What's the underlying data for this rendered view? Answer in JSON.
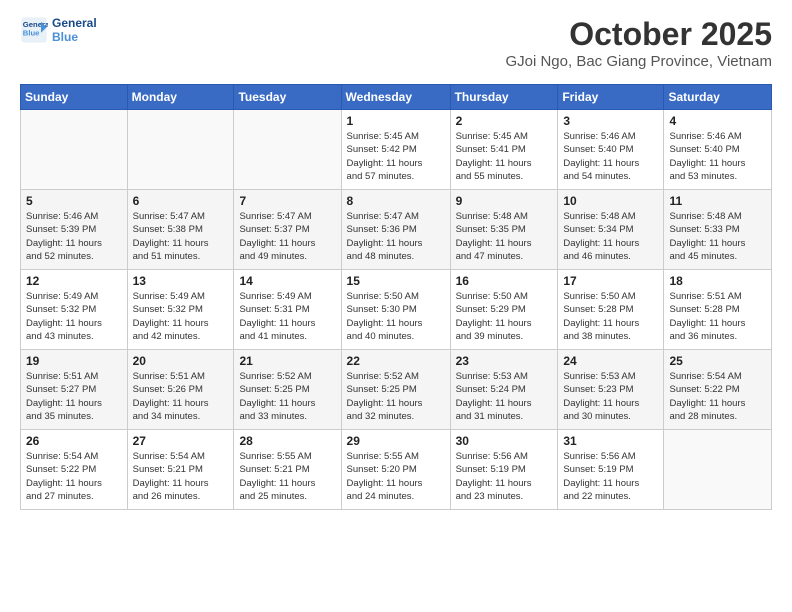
{
  "app": {
    "logo_line1": "General",
    "logo_line2": "Blue"
  },
  "header": {
    "month": "October 2025",
    "location": "GJoi Ngo, Bac Giang Province, Vietnam"
  },
  "weekdays": [
    "Sunday",
    "Monday",
    "Tuesday",
    "Wednesday",
    "Thursday",
    "Friday",
    "Saturday"
  ],
  "weeks": [
    [
      {
        "day": "",
        "info": ""
      },
      {
        "day": "",
        "info": ""
      },
      {
        "day": "",
        "info": ""
      },
      {
        "day": "1",
        "info": "Sunrise: 5:45 AM\nSunset: 5:42 PM\nDaylight: 11 hours\nand 57 minutes."
      },
      {
        "day": "2",
        "info": "Sunrise: 5:45 AM\nSunset: 5:41 PM\nDaylight: 11 hours\nand 55 minutes."
      },
      {
        "day": "3",
        "info": "Sunrise: 5:46 AM\nSunset: 5:40 PM\nDaylight: 11 hours\nand 54 minutes."
      },
      {
        "day": "4",
        "info": "Sunrise: 5:46 AM\nSunset: 5:40 PM\nDaylight: 11 hours\nand 53 minutes."
      }
    ],
    [
      {
        "day": "5",
        "info": "Sunrise: 5:46 AM\nSunset: 5:39 PM\nDaylight: 11 hours\nand 52 minutes."
      },
      {
        "day": "6",
        "info": "Sunrise: 5:47 AM\nSunset: 5:38 PM\nDaylight: 11 hours\nand 51 minutes."
      },
      {
        "day": "7",
        "info": "Sunrise: 5:47 AM\nSunset: 5:37 PM\nDaylight: 11 hours\nand 49 minutes."
      },
      {
        "day": "8",
        "info": "Sunrise: 5:47 AM\nSunset: 5:36 PM\nDaylight: 11 hours\nand 48 minutes."
      },
      {
        "day": "9",
        "info": "Sunrise: 5:48 AM\nSunset: 5:35 PM\nDaylight: 11 hours\nand 47 minutes."
      },
      {
        "day": "10",
        "info": "Sunrise: 5:48 AM\nSunset: 5:34 PM\nDaylight: 11 hours\nand 46 minutes."
      },
      {
        "day": "11",
        "info": "Sunrise: 5:48 AM\nSunset: 5:33 PM\nDaylight: 11 hours\nand 45 minutes."
      }
    ],
    [
      {
        "day": "12",
        "info": "Sunrise: 5:49 AM\nSunset: 5:32 PM\nDaylight: 11 hours\nand 43 minutes."
      },
      {
        "day": "13",
        "info": "Sunrise: 5:49 AM\nSunset: 5:32 PM\nDaylight: 11 hours\nand 42 minutes."
      },
      {
        "day": "14",
        "info": "Sunrise: 5:49 AM\nSunset: 5:31 PM\nDaylight: 11 hours\nand 41 minutes."
      },
      {
        "day": "15",
        "info": "Sunrise: 5:50 AM\nSunset: 5:30 PM\nDaylight: 11 hours\nand 40 minutes."
      },
      {
        "day": "16",
        "info": "Sunrise: 5:50 AM\nSunset: 5:29 PM\nDaylight: 11 hours\nand 39 minutes."
      },
      {
        "day": "17",
        "info": "Sunrise: 5:50 AM\nSunset: 5:28 PM\nDaylight: 11 hours\nand 38 minutes."
      },
      {
        "day": "18",
        "info": "Sunrise: 5:51 AM\nSunset: 5:28 PM\nDaylight: 11 hours\nand 36 minutes."
      }
    ],
    [
      {
        "day": "19",
        "info": "Sunrise: 5:51 AM\nSunset: 5:27 PM\nDaylight: 11 hours\nand 35 minutes."
      },
      {
        "day": "20",
        "info": "Sunrise: 5:51 AM\nSunset: 5:26 PM\nDaylight: 11 hours\nand 34 minutes."
      },
      {
        "day": "21",
        "info": "Sunrise: 5:52 AM\nSunset: 5:25 PM\nDaylight: 11 hours\nand 33 minutes."
      },
      {
        "day": "22",
        "info": "Sunrise: 5:52 AM\nSunset: 5:25 PM\nDaylight: 11 hours\nand 32 minutes."
      },
      {
        "day": "23",
        "info": "Sunrise: 5:53 AM\nSunset: 5:24 PM\nDaylight: 11 hours\nand 31 minutes."
      },
      {
        "day": "24",
        "info": "Sunrise: 5:53 AM\nSunset: 5:23 PM\nDaylight: 11 hours\nand 30 minutes."
      },
      {
        "day": "25",
        "info": "Sunrise: 5:54 AM\nSunset: 5:22 PM\nDaylight: 11 hours\nand 28 minutes."
      }
    ],
    [
      {
        "day": "26",
        "info": "Sunrise: 5:54 AM\nSunset: 5:22 PM\nDaylight: 11 hours\nand 27 minutes."
      },
      {
        "day": "27",
        "info": "Sunrise: 5:54 AM\nSunset: 5:21 PM\nDaylight: 11 hours\nand 26 minutes."
      },
      {
        "day": "28",
        "info": "Sunrise: 5:55 AM\nSunset: 5:21 PM\nDaylight: 11 hours\nand 25 minutes."
      },
      {
        "day": "29",
        "info": "Sunrise: 5:55 AM\nSunset: 5:20 PM\nDaylight: 11 hours\nand 24 minutes."
      },
      {
        "day": "30",
        "info": "Sunrise: 5:56 AM\nSunset: 5:19 PM\nDaylight: 11 hours\nand 23 minutes."
      },
      {
        "day": "31",
        "info": "Sunrise: 5:56 AM\nSunset: 5:19 PM\nDaylight: 11 hours\nand 22 minutes."
      },
      {
        "day": "",
        "info": ""
      }
    ]
  ]
}
